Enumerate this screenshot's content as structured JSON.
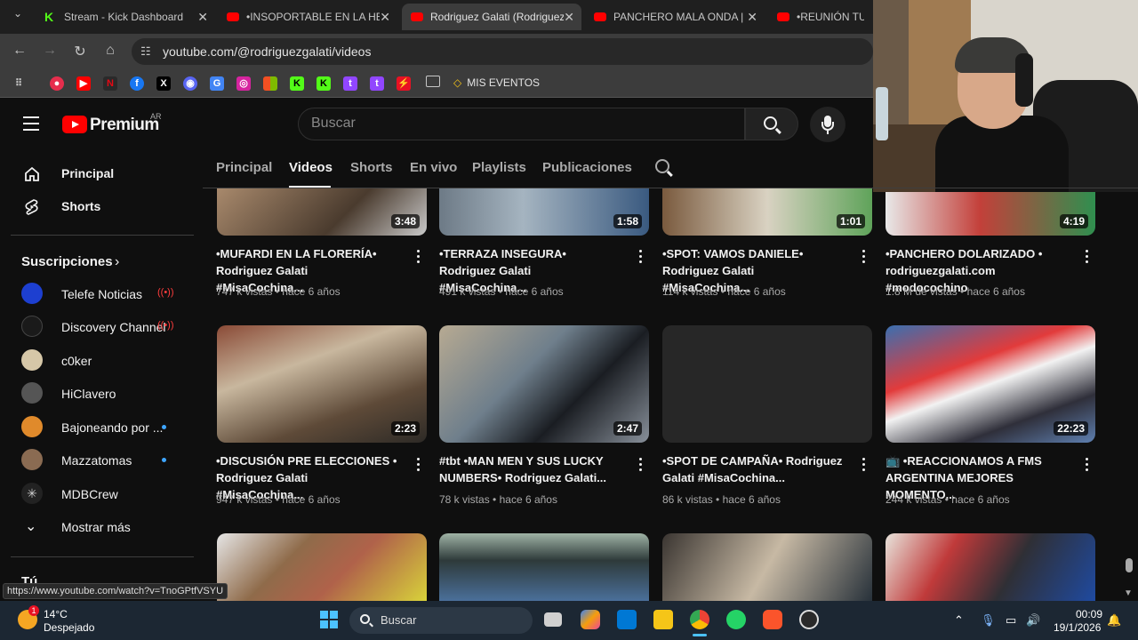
{
  "browser": {
    "tabs": [
      {
        "title": "Stream - Kick Dashboard",
        "favicon": "kick-icon"
      },
      {
        "title": "•INSOPORTABLE EN LA HELADERÍA•",
        "favicon": "youtube-icon"
      },
      {
        "title": "Rodriguez Galati (Rodriguez Galati)",
        "favicon": "youtube-icon"
      },
      {
        "title": "PANCHERO MALA ONDA | R",
        "favicon": "youtube-icon"
      },
      {
        "title": "•REUNIÓN TURBIA",
        "favicon": "youtube-icon"
      }
    ],
    "url": "youtube.com/@rodriguezgalati/videos",
    "bookmark_folder_label": "MIS EVENTOS",
    "status_url": "https://www.youtube.com/watch?v=TnoGPtfVSYU"
  },
  "youtube": {
    "brand": "Premium",
    "country": "AR",
    "search_placeholder": "Buscar",
    "sidebar": {
      "nav": [
        {
          "label": "Principal",
          "icon": "home-icon"
        },
        {
          "label": "Shorts",
          "icon": "shorts-icon"
        }
      ],
      "subscriptions_title": "Suscripciones",
      "subscriptions": [
        {
          "label": "Telefe Noticias",
          "badge": "live"
        },
        {
          "label": "Discovery Channel",
          "badge": "live"
        },
        {
          "label": "c0ker",
          "badge": ""
        },
        {
          "label": "HiClavero",
          "badge": ""
        },
        {
          "label": "Bajoneando por ...",
          "badge": "new"
        },
        {
          "label": "Mazzatomas",
          "badge": "new"
        },
        {
          "label": "MDBCrew",
          "badge": ""
        }
      ],
      "show_more": "Mostrar más",
      "you_section": "Tú"
    },
    "channel_tabs": [
      "Principal",
      "Videos",
      "Shorts",
      "En vivo",
      "Playlists",
      "Publicaciones"
    ],
    "active_tab": "Videos",
    "videos": [
      {
        "title": "•MUFARDI EN LA FLORERÍA• Rodriguez Galati #MisaCochina...",
        "views": "747 k vistas",
        "age": "hace 6 años",
        "duration": "3:48"
      },
      {
        "title": "•TERRAZA INSEGURA• Rodriguez Galati #MisaCochina...",
        "views": "491 k vistas",
        "age": "hace 6 años",
        "duration": "1:58"
      },
      {
        "title": "•SPOT: VAMOS DANIELE• Rodriguez Galati #MisaCochina...",
        "views": "114 k vistas",
        "age": "hace 6 años",
        "duration": "1:01"
      },
      {
        "title": "•PANCHERO DOLARIZADO • rodriguezgalati.com #modocochino",
        "views": "1.8 M de vistas",
        "age": "hace 6 años",
        "duration": "4:19"
      },
      {
        "title": "•DISCUSIÓN PRE ELECCIONES • Rodriguez Galati #MisaCochina...",
        "views": "947 k vistas",
        "age": "hace 6 años",
        "duration": "2:23"
      },
      {
        "title": "#tbt •MAN MEN Y SUS LUCKY NUMBERS• Rodriguez Galati...",
        "views": "78 k vistas",
        "age": "hace 6 años",
        "duration": "2:47"
      },
      {
        "title": "•SPOT DE CAMPAÑA• Rodriguez Galati #MisaCochina...",
        "views": "86 k vistas",
        "age": "hace 6 años",
        "duration": ""
      },
      {
        "title": "📺 •REACCIONAMOS A FMS ARGENTINA MEJORES MOMENTO...",
        "views": "244 k vistas",
        "age": "hace 6 años",
        "duration": "22:23"
      }
    ],
    "meta_separator": "•"
  },
  "taskbar": {
    "temperature": "14°C",
    "condition": "Despejado",
    "weather_badge": "1",
    "search_label": "Buscar",
    "time": "00:09",
    "date": "19/1/2026"
  },
  "colors": {
    "background": "#0f0f0f",
    "youtube_red": "#ff0000",
    "live_red": "#ff3d3d",
    "new_dot": "#3ea6ff",
    "taskbar": "#1c2733"
  }
}
